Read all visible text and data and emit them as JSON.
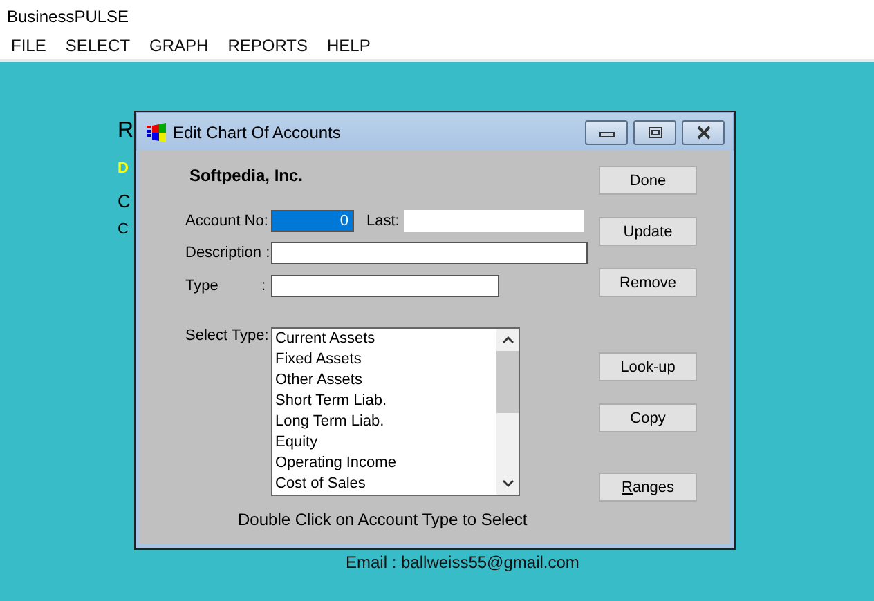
{
  "window": {
    "title": "BusinessPULSE"
  },
  "menu": [
    "FILE",
    "SELECT",
    "GRAPH",
    "REPORTS",
    "HELP"
  ],
  "background_texts": [
    {
      "text": "R",
      "kind": "large"
    },
    {
      "text": "D",
      "kind": "highlight"
    },
    {
      "text": "C",
      "kind": "normal"
    },
    {
      "text": "C",
      "kind": "small"
    }
  ],
  "email": "Email :  ballweiss55@gmail.com",
  "dialog": {
    "title": "Edit Chart Of Accounts",
    "company": "Softpedia, Inc.",
    "account_no": {
      "label": "Account No:",
      "value": "0",
      "highlighted": true
    },
    "last": {
      "label": "Last:"
    },
    "description": {
      "label": "Description :"
    },
    "type": {
      "label": "Type",
      "colon": ":"
    },
    "select_type": {
      "label": "Select Type:",
      "items": [
        {
          "label": "Current Assets",
          "selected": false
        },
        {
          "label": "Fixed Assets",
          "selected": false
        },
        {
          "label": "Other Assets",
          "selected": false
        },
        {
          "label": "Short Term Liab.",
          "selected": false
        },
        {
          "label": "Long Term Liab.",
          "selected": false
        },
        {
          "label": "Equity",
          "selected": false
        },
        {
          "label": "Operating Income",
          "selected": false
        },
        {
          "label": "Cost of Sales",
          "selected": false
        }
      ]
    },
    "hint": "Double Click on Account Type to Select",
    "buttons": [
      {
        "label": "Done",
        "underline_first": false
      },
      {
        "label": "Update",
        "underline_first": false
      },
      {
        "label": "Remove",
        "underline_first": false
      },
      {
        "label": "Look-up",
        "underline_first": false
      },
      {
        "label": "Copy",
        "underline_first": false
      },
      {
        "label": "Ranges",
        "underline_first": true
      }
    ]
  }
}
